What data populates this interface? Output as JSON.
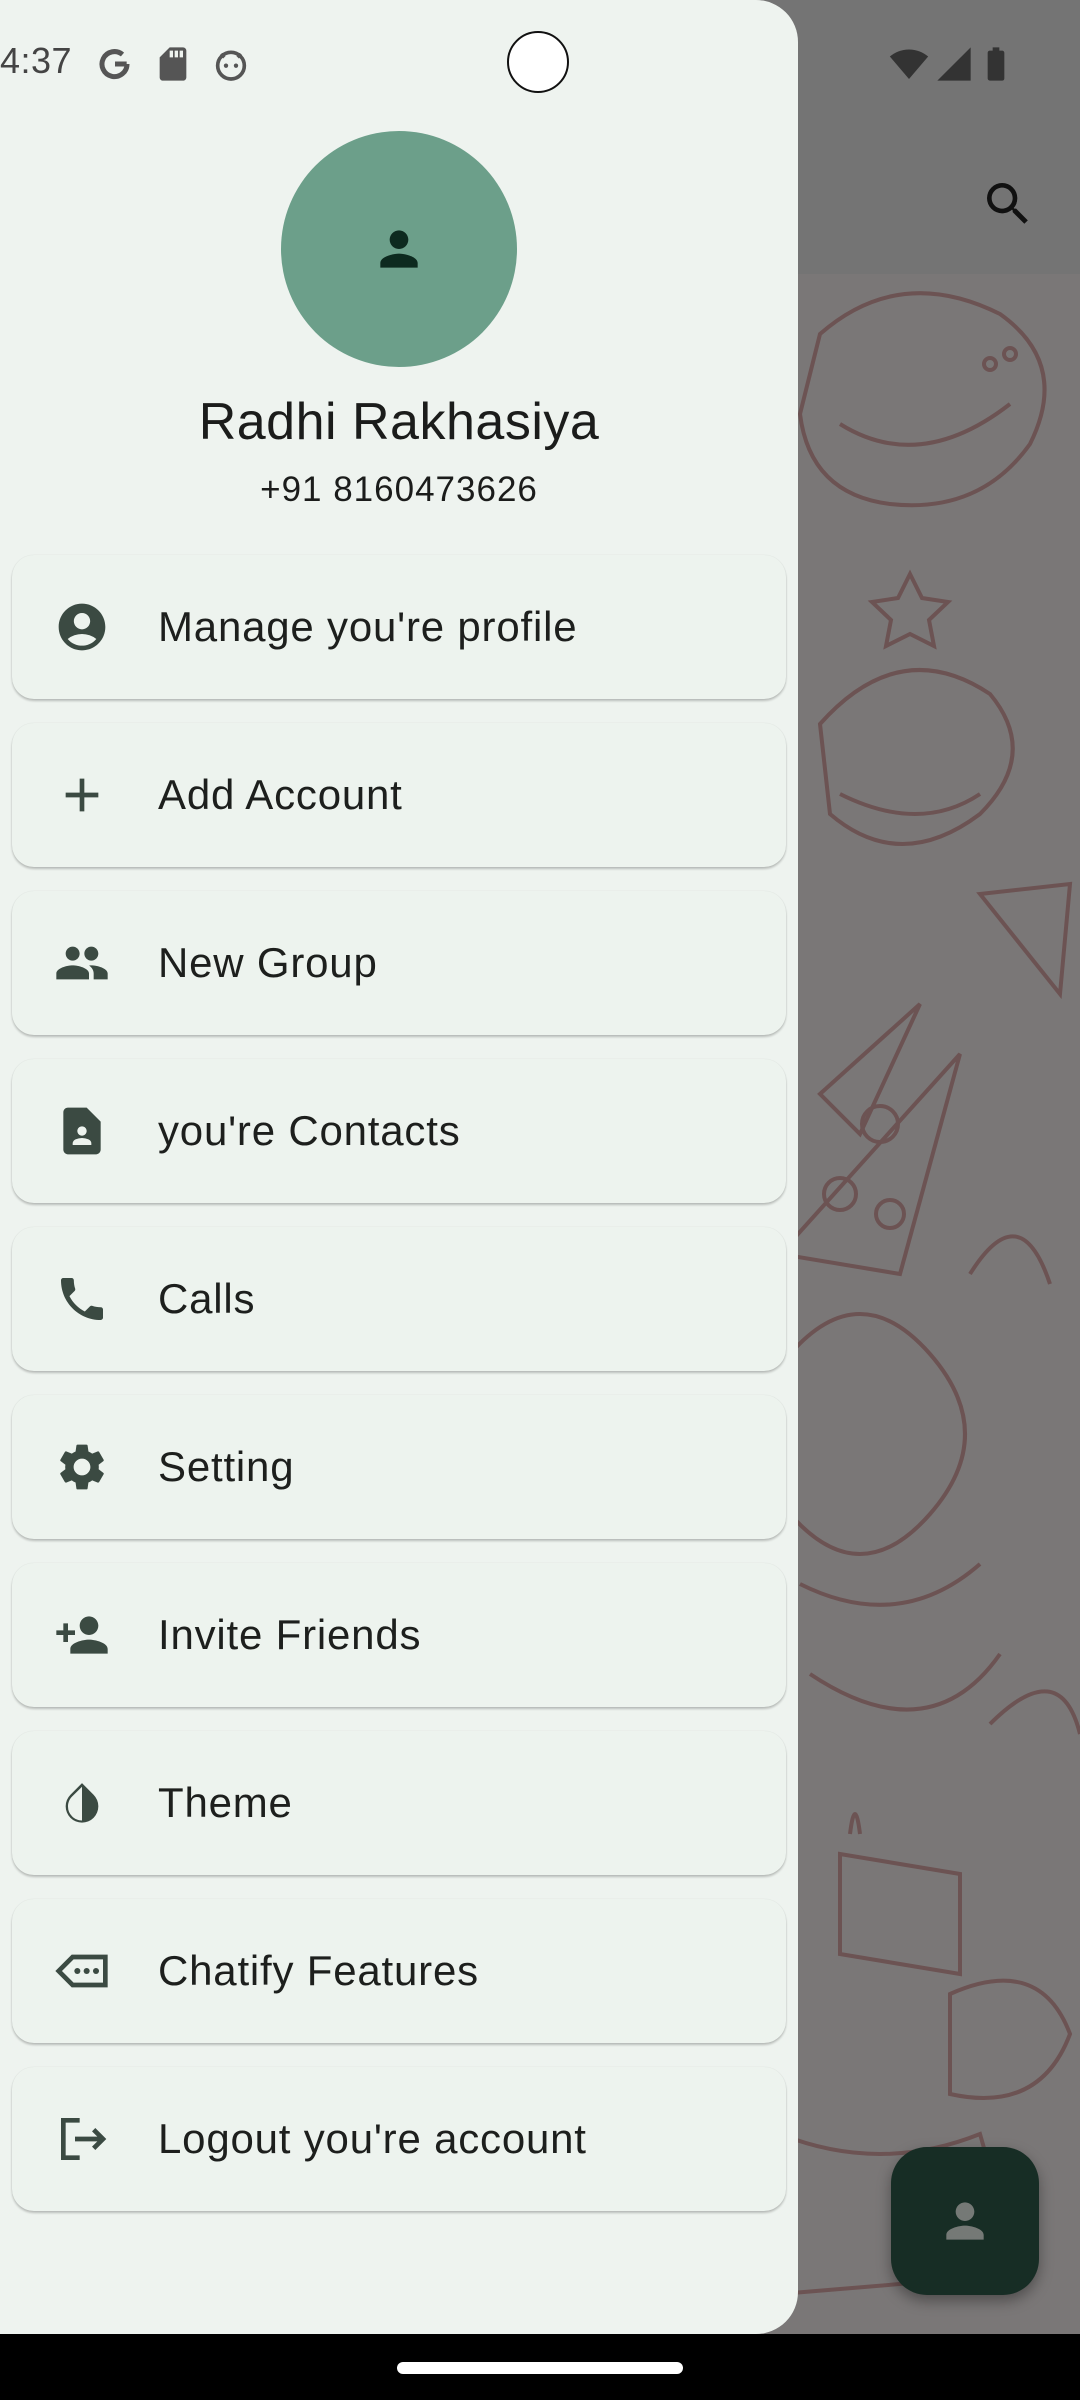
{
  "status_bar": {
    "time": "4:37",
    "left_icons": [
      "google-icon",
      "sd-card-icon",
      "android-debug-icon"
    ],
    "right_icons": [
      "wifi-icon",
      "cell-signal-icon",
      "battery-icon"
    ]
  },
  "profile": {
    "name": "Radhi Rakhasiya",
    "phone": "+91 8160473626"
  },
  "menu": {
    "items": [
      {
        "label": "Manage you're profile",
        "icon": "account-circle-icon"
      },
      {
        "label": "Add Account",
        "icon": "add-icon"
      },
      {
        "label": "New Group",
        "icon": "group-icon"
      },
      {
        "label": "you're Contacts",
        "icon": "contact-page-icon"
      },
      {
        "label": "Calls",
        "icon": "phone-icon"
      },
      {
        "label": "Setting",
        "icon": "gear-icon"
      },
      {
        "label": "Invite Friends",
        "icon": "person-add-icon"
      },
      {
        "label": "Theme",
        "icon": "contrast-icon"
      },
      {
        "label": "Chatify Features",
        "icon": "feature-tag-icon"
      },
      {
        "label": "Logout you're account",
        "icon": "logout-icon"
      }
    ]
  },
  "colors": {
    "drawer_bg": "#eef3ef",
    "avatar_bg": "#6c9f8a",
    "fab_bg": "#2f5b4a",
    "icon": "#3b4a42"
  }
}
